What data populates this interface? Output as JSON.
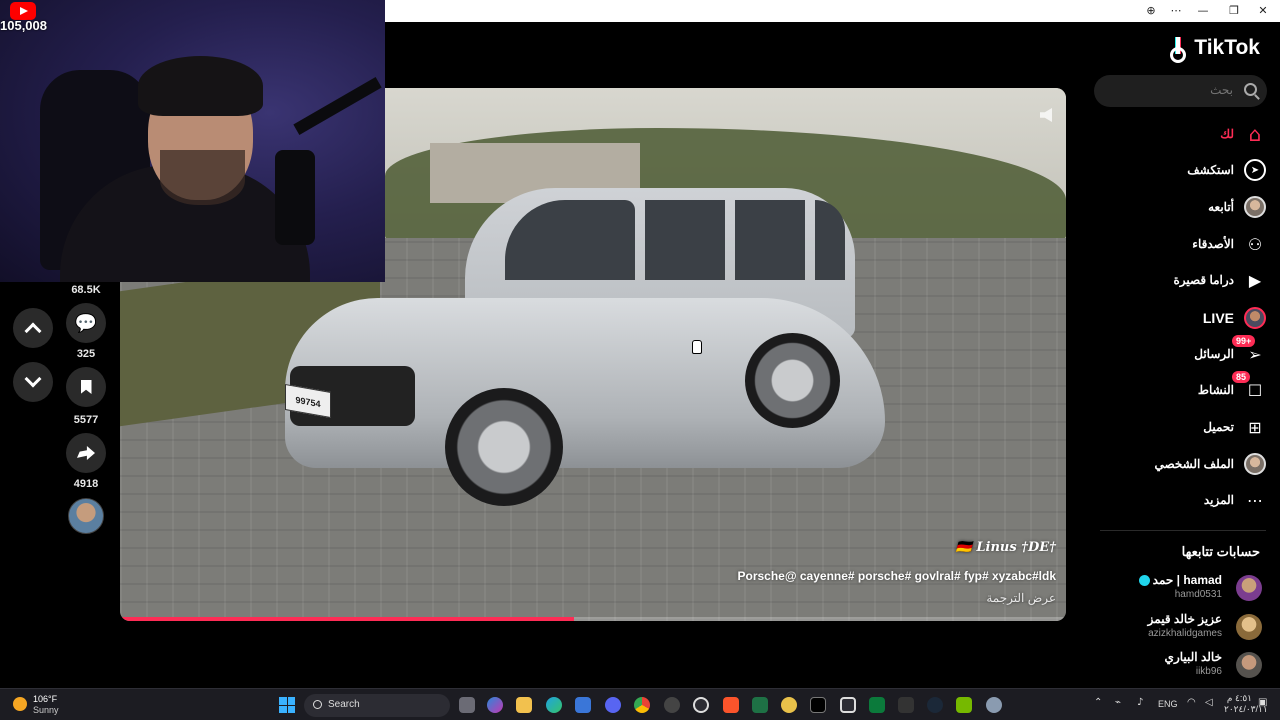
{
  "stream_overlay": {
    "viewer_count": "105,008"
  },
  "window_controls": {
    "zoom": "⊕",
    "more": "⋯",
    "minimize": "—",
    "maximize": "❐",
    "close": "✕"
  },
  "video": {
    "author": "🇩🇪 Linus †DE†",
    "caption": "Porsche@ cayenne# porsche# govlral# fyp# xyzabc#ldk",
    "translate_label": "عرض الترجمة",
    "plate_text": "99754",
    "progress_fraction": 0.48
  },
  "actions": {
    "top_count": "68.5K",
    "comments_count": "325",
    "saves_count": "5577",
    "shares_count": "4918"
  },
  "sidebar": {
    "logo_text": "TikTok",
    "search_placeholder": "بحث",
    "items": [
      {
        "label": "لك",
        "icon": "home-icon"
      },
      {
        "label": "استكشف",
        "icon": "compass-icon"
      },
      {
        "label": "أتابعه",
        "icon": "following-avatar-icon"
      },
      {
        "label": "الأصدقاء",
        "icon": "friends-icon"
      },
      {
        "label": "دراما قصيرة",
        "icon": "drama-icon"
      },
      {
        "label": "LIVE",
        "icon": "live-avatar-icon"
      },
      {
        "label": "الرسائل",
        "icon": "messages-icon",
        "badge": "99+"
      },
      {
        "label": "النشاط",
        "icon": "activity-icon",
        "badge": "85"
      },
      {
        "label": "تحميل",
        "icon": "upload-icon"
      },
      {
        "label": "الملف الشخصي",
        "icon": "profile-avatar-icon"
      },
      {
        "label": "المزيد",
        "icon": "more-icon"
      }
    ],
    "following_title": "حسابات تتابعها",
    "accounts": [
      {
        "name": "حمد | hamad",
        "handle": "hamd0531",
        "verified": true
      },
      {
        "name": "عزيز خالد قيمز",
        "handle": "azizkhalidgames",
        "verified": false
      },
      {
        "name": "خالد البياري",
        "handle": "iikb96",
        "verified": false
      }
    ]
  },
  "taskbar": {
    "weather_temp": "106°F",
    "weather_cond": "Sunny",
    "search_label": "Search",
    "language": "ENG",
    "clock_time": "٤:٥١ م",
    "clock_date": "٢٠٢٤/٠٣/١١"
  }
}
